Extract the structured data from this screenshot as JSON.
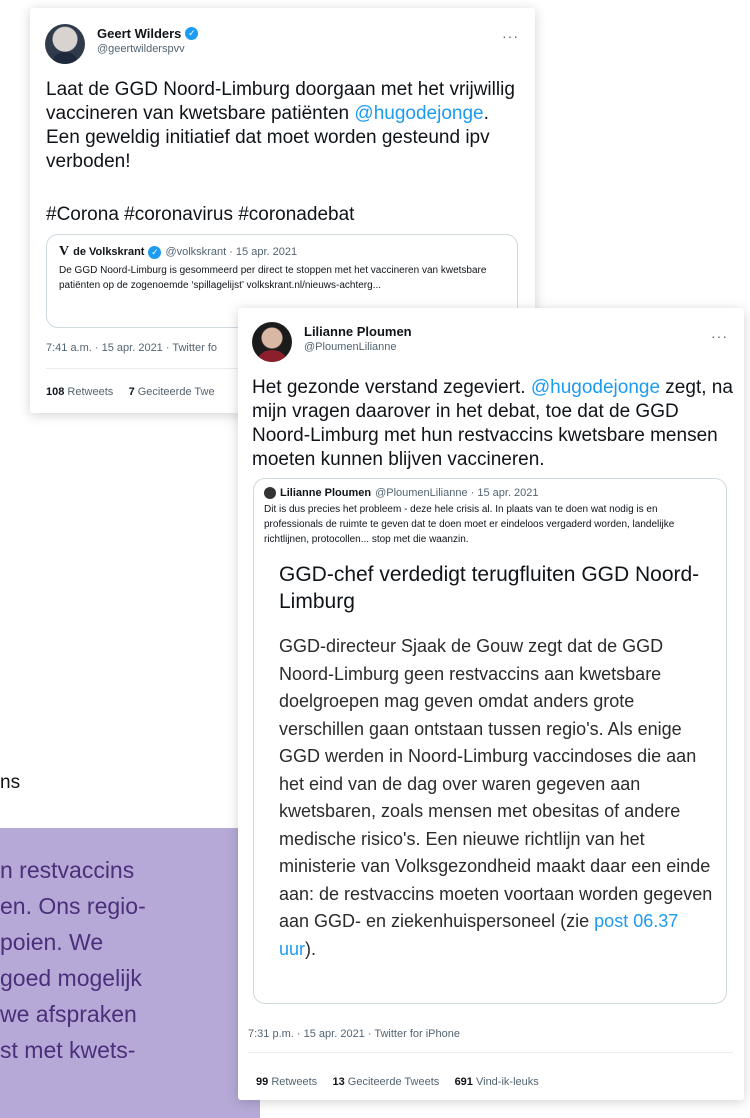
{
  "background": {
    "snippet_text": "ns",
    "purple_lines": [
      "n restvaccins",
      "en. Ons regio-",
      "poien. We",
      "goed mogelijk",
      "we afspraken",
      "st met kwets-"
    ]
  },
  "tweet1": {
    "name": "Geert Wilders",
    "handle": "@geertwilderspvv",
    "more": "···",
    "text_plain_1": "Laat de GGD Noord-Limburg doorgaan met het vrijwillig vaccineren van kwetsbare patiënten ",
    "mention": "@hugodejonge",
    "text_plain_2": ". Een geweldig initiatief dat moet worden gesteund ipv verboden!",
    "hashtags": "#Corona #coronavirus #coronadebat",
    "quote": {
      "logo": "V",
      "name": "de Volkskrant",
      "handle_time": "@volkskrant · 15 apr. 2021",
      "text": "De GGD Noord-Limburg is gesommeerd per direct te stoppen met het vaccineren van kwetsbare patiënten op de zogenoemde ‘spillagelijst’ volkskrant.nl/nieuws-achterg..."
    },
    "meta": "7:41 a.m. · 15 apr. 2021 · Twitter fo",
    "stats": {
      "retweets_count": "108",
      "retweets_label": "Retweets",
      "quotes_count": "7",
      "quotes_label": "Geciteerde Twe"
    }
  },
  "tweet2": {
    "name": "Lilianne Ploumen",
    "handle": "@PloumenLilianne",
    "more": "···",
    "text_plain_1": "Het gezonde verstand zegeviert. ",
    "mention": "@hugodejonge",
    "text_plain_2": " zegt, na mijn vragen daarover in het debat, toe dat de GGD Noord-Limburg met hun restvaccins  kwetsbare mensen moeten kunnen blijven vaccineren.",
    "quote": {
      "name": "Lilianne Ploumen",
      "handle_time": "@PloumenLilianne · 15 apr. 2021",
      "text": "Dit is dus precies het probleem - deze hele crisis al. In plaats van te doen wat nodig is en professionals de ruimte te geven dat te doen moet er eindeloos vergaderd worden, landelijke richtlijnen, protocollen... stop met die waanzin.",
      "article_title": "GGD-chef verdedigt terugfluiten GGD Noord-Limburg",
      "article_body": "GGD-directeur Sjaak de Gouw zegt dat de GGD Noord-Limburg geen restvaccins aan kwetsbare doelgroepen mag geven omdat anders grote verschillen gaan ontstaan tussen regio's. Als enige GGD werden in Noord-Limburg vaccindoses die aan het eind van de dag over waren gegeven aan kwetsbaren, zoals mensen met obesitas of andere medische risico's. Een nieuwe richtlijn van het ministerie van Volksgezondheid maakt daar een einde aan: de restvaccins moeten voortaan worden gegeven aan GGD- en ziekenhuispersoneel (zie ",
      "article_link": "post 06.37 uur",
      "article_end": ")."
    },
    "meta": "7:31 p.m. · 15 apr. 2021 · Twitter for iPhone",
    "stats": {
      "retweets_count": "99",
      "retweets_label": "Retweets",
      "quotes_count": "13",
      "quotes_label": "Geciteerde Tweets",
      "likes_count": "691",
      "likes_label": "Vind-ik-leuks"
    }
  }
}
